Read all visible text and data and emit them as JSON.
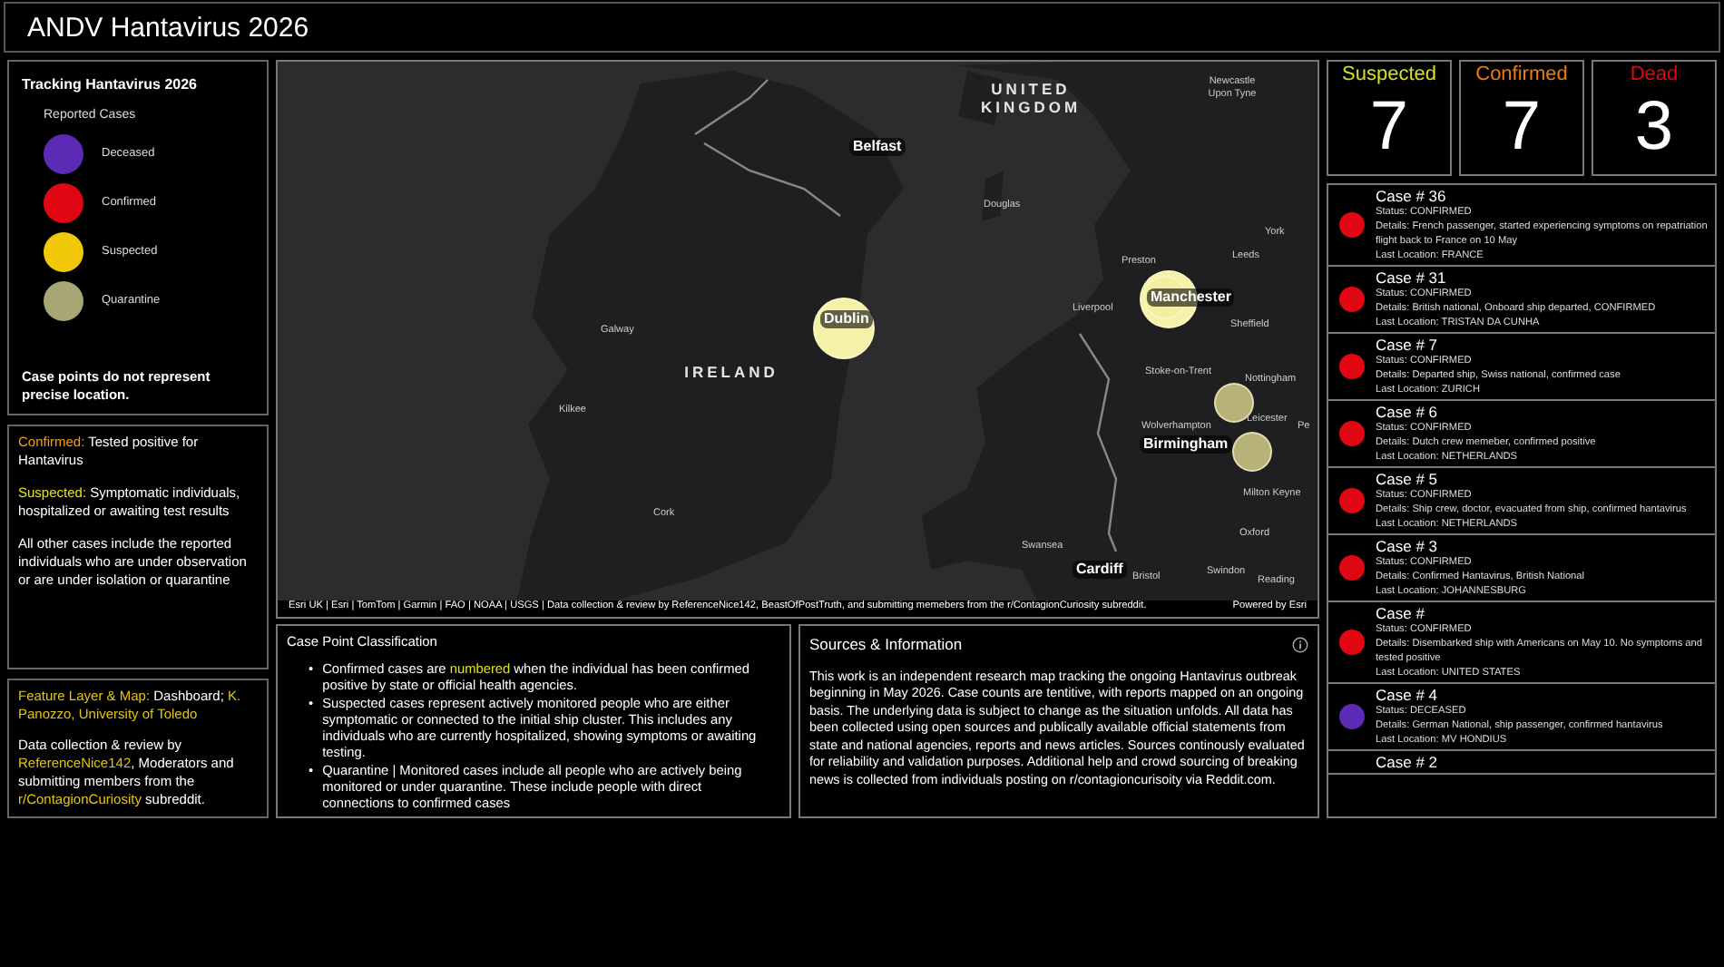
{
  "header": {
    "title": "ANDV Hantavirus 2026"
  },
  "legend": {
    "title": "Tracking Hantavirus 2026",
    "subtitle": "Reported Cases",
    "items": [
      {
        "label": "Deceased",
        "color": "#5b2bb5"
      },
      {
        "label": "Confirmed",
        "color": "#e00712"
      },
      {
        "label": "Suspected",
        "color": "#f0c808"
      },
      {
        "label": "Quarantine",
        "color": "#a8a673"
      }
    ],
    "note": "Case points do not represent precise location."
  },
  "definitions": [
    {
      "term": "Confirmed:",
      "text": "Tested positive for Hantavirus",
      "color": "#f59e0b"
    },
    {
      "term": "Suspected:",
      "text": "Symptomatic individuals, hospitalized or awaiting test results",
      "color": "#e5e510"
    },
    {
      "text": "All other cases include the reported individuals who are under observation or are under isolation or quarantine"
    }
  ],
  "credits": [
    [
      {
        "text": "Feature Layer & Map:",
        "highlight": true
      },
      {
        "text": " Dashboard; ",
        "highlight": false
      },
      {
        "text": "K. Panozzo, University of Toledo",
        "highlight": true
      }
    ],
    [
      {
        "text": "Data collection & review by ",
        "highlight": false
      },
      {
        "text": "ReferenceNice142",
        "highlight": true
      },
      {
        "text": ", Moderators and submitting members from the ",
        "highlight": false
      },
      {
        "text": "r/ContagionCuriosity",
        "highlight": true
      },
      {
        "text": " subreddit.",
        "highlight": false
      }
    ]
  ],
  "map": {
    "labels": [
      {
        "text": "Newcastle Upon Tyne",
        "kind": "town"
      },
      {
        "text": "UNITED KINGDOM",
        "kind": "country"
      },
      {
        "text": "Belfast",
        "kind": "city"
      },
      {
        "text": "Douglas",
        "kind": "town"
      },
      {
        "text": "York",
        "kind": "town"
      },
      {
        "text": "Leeds",
        "kind": "town"
      },
      {
        "text": "Preston",
        "kind": "town"
      },
      {
        "text": "Manchester",
        "kind": "city"
      },
      {
        "text": "Liverpool",
        "kind": "town"
      },
      {
        "text": "Dublin",
        "kind": "city"
      },
      {
        "text": "Sheffield",
        "kind": "town"
      },
      {
        "text": "Galway",
        "kind": "town"
      },
      {
        "text": "IRELAND",
        "kind": "country"
      },
      {
        "text": "Stoke-on-Trent",
        "kind": "town"
      },
      {
        "text": "Nottingham",
        "kind": "town"
      },
      {
        "text": "Kilkee",
        "kind": "town"
      },
      {
        "text": "Leicester",
        "kind": "town"
      },
      {
        "text": "Wolverhampton",
        "kind": "town"
      },
      {
        "text": "Pe",
        "kind": "town"
      },
      {
        "text": "Birmingham",
        "kind": "city"
      },
      {
        "text": "Milton Keyne",
        "kind": "town"
      },
      {
        "text": "Cork",
        "kind": "town"
      },
      {
        "text": "Oxford",
        "kind": "town"
      },
      {
        "text": "Swansea",
        "kind": "town"
      },
      {
        "text": "Cardiff",
        "kind": "city"
      },
      {
        "text": "Swindon",
        "kind": "town"
      },
      {
        "text": "Bristol",
        "kind": "town"
      },
      {
        "text": "Reading",
        "kind": "town"
      }
    ],
    "attribution": "Esri UK | Esri | TomTom | Garmin | FAO | NOAA | USGS | Data collection & review by ReferenceNice142, BeastOfPostTruth, and submitting memebers from the r/ContagionCuriosity subreddit.",
    "powered_by": "Powered by Esri"
  },
  "stats": [
    {
      "label": "Suspected",
      "value": "7",
      "color": "#d4e020"
    },
    {
      "label": "Confirmed",
      "value": "7",
      "color": "#f07d0a"
    },
    {
      "label": "Dead",
      "value": "3",
      "color": "#e00712"
    }
  ],
  "cases": [
    {
      "title": "Case # 36",
      "status": "Status: CONFIRMED",
      "details": "Details: French passenger, started experiencing symptoms on repatriation flight back to France on 10 May",
      "location": "Last Location: FRANCE",
      "color": "#e00712"
    },
    {
      "title": "Case # 31",
      "status": "Status: CONFIRMED",
      "details": "Details: British national, Onboard ship departed, CONFIRMED",
      "location": "Last Location: TRISTAN DA CUNHA",
      "color": "#e00712"
    },
    {
      "title": "Case # 7",
      "status": "Status: CONFIRMED",
      "details": "Details: Departed ship, Swiss national, confirmed case",
      "location": "Last Location: ZURICH",
      "color": "#e00712"
    },
    {
      "title": "Case # 6",
      "status": "Status: CONFIRMED",
      "details": "Details: Dutch crew memeber, confirmed positive",
      "location": "Last Location: NETHERLANDS",
      "color": "#e00712"
    },
    {
      "title": "Case # 5",
      "status": "Status: CONFIRMED",
      "details": "Details: Ship crew, doctor, evacuated from ship, confirmed hantavirus",
      "location": "Last Location: NETHERLANDS",
      "color": "#e00712"
    },
    {
      "title": "Case # 3",
      "status": "Status: CONFIRMED",
      "details": "Details: Confirmed Hantavirus, British National",
      "location": "Last Location: JOHANNESBURG",
      "color": "#e00712"
    },
    {
      "title": "Case #",
      "status": "Status: CONFIRMED",
      "details": "Details: Disembarked ship with Americans on May 10. No symptoms and tested positive",
      "location": "Last Location: UNITED STATES",
      "color": "#e00712"
    },
    {
      "title": "Case # 4",
      "status": "Status: DECEASED",
      "details": "Details: German National, ship passenger, confirmed hantavirus",
      "location": "Last Location: MV HONDIUS",
      "color": "#5b2bb5"
    },
    {
      "title": "Case # 2"
    }
  ],
  "classification": {
    "title": "Case Point Classification",
    "bullets": [
      {
        "marker": "•",
        "segments": [
          {
            "text": "Confirmed cases are ",
            "highlight": false
          },
          {
            "text": "numbered",
            "highlight": true
          },
          {
            "text": " when the individual has been confirmed positive by state or official health agencies.",
            "highlight": false
          }
        ]
      },
      {
        "marker": "•",
        "segments": [
          {
            "text": "Suspected cases represent actively monitored people who are either symptomatic or connected to the initial ship cluster. This includes any individuals who are currently hospitalized, showing symptoms or awaiting testing.",
            "highlight": false
          }
        ]
      },
      {
        "marker": "•",
        "segments": [
          {
            "text": "Quarantine | Monitored cases include all people who are actively being monitored or under quarantine. These include people with direct connections to confirmed cases",
            "highlight": false
          }
        ]
      }
    ]
  },
  "sources": {
    "title": "Sources & Information",
    "body": "This work is an independent research map tracking the ongoing Hantavirus outbreak beginning in May 2026. Case counts are tentitive, with reports mapped on an ongoing basis. The underlying data is subject to change as the situation unfolds. All data has been collected using open sources and publically available official statements from state and national agencies, reports and news articles. Sources continously evaluated for reliability and validation purposes. Additional help and crowd sourcing of breaking news is collected from individuals posting on r/contagioncurisoity via Reddit.com."
  }
}
